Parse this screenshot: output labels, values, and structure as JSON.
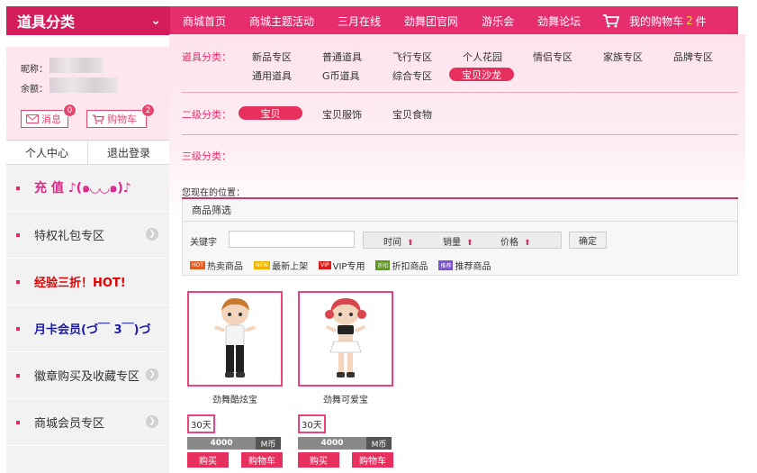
{
  "header": {
    "category_title": "道具分类",
    "nav": [
      "商城首页",
      "商城主题活动",
      "三月在线",
      "劲舞团官网",
      "游乐会",
      "劲舞论坛"
    ],
    "cart_prefix": "我的购物车",
    "cart_count": "2",
    "cart_suffix": "件"
  },
  "user": {
    "nickname_label": "昵称：",
    "balance_label": "余额：",
    "message_label": "消息",
    "message_badge": "0",
    "cart_label": "购物车",
    "cart_badge": "2",
    "center_label": "个人中心",
    "logout_label": "退出登录"
  },
  "sidebar": {
    "items": [
      {
        "label": "充 值 ♪(๑◡◡๑)♪",
        "color": "#e0238b"
      },
      {
        "label": "特权礼包专区",
        "color": "#333333"
      },
      {
        "label": "经验三折！HOT!",
        "color": "#e00000"
      },
      {
        "label": "月卡会员(づ￣ 3￣)づ",
        "color": "#1a1aa6"
      },
      {
        "label": "徽章购买及收藏专区",
        "color": "#333333"
      },
      {
        "label": "商城会员专区",
        "color": "#333333"
      }
    ]
  },
  "filters": {
    "cat_label": "道具分类：",
    "cat_items": [
      "新品专区",
      "普通道具",
      "飞行专区",
      "个人花园",
      "情侣专区",
      "家族专区",
      "品牌专区",
      "通用道具",
      "G币道具",
      "综合专区",
      "宝贝沙龙"
    ],
    "level2_label": "二级分类：",
    "level2_items": [
      "宝贝",
      "宝贝服饰",
      "宝贝食物"
    ],
    "level3_label": "三级分类：",
    "location_label": "您现在的位置：",
    "screen_title": "商品筛选",
    "keyword_label": "关键字",
    "sort_time": "时间",
    "sort_sales": "销量",
    "sort_price": "价格",
    "confirm": "确定",
    "tags": [
      {
        "badge": "HOT",
        "label": "热卖商品",
        "color": "#e55a1c"
      },
      {
        "badge": "NEW",
        "label": "最新上架",
        "color": "#f0b400"
      },
      {
        "badge": "VIP",
        "label": "VIP专用",
        "color": "#d91c1c"
      },
      {
        "badge": "折扣",
        "label": "折扣商品",
        "color": "#5b9a1a"
      },
      {
        "badge": "推荐",
        "label": "推荐商品",
        "color": "#7a4fd1"
      }
    ]
  },
  "products": [
    {
      "name": "劲舞酷炫宝",
      "days": "30天",
      "price": "4000",
      "unit": "M币",
      "buy": "购买",
      "cart": "购物车"
    },
    {
      "name": "劲舞可爱宝",
      "days": "30天",
      "price": "4000",
      "unit": "M币",
      "buy": "购买",
      "cart": "购物车"
    }
  ]
}
